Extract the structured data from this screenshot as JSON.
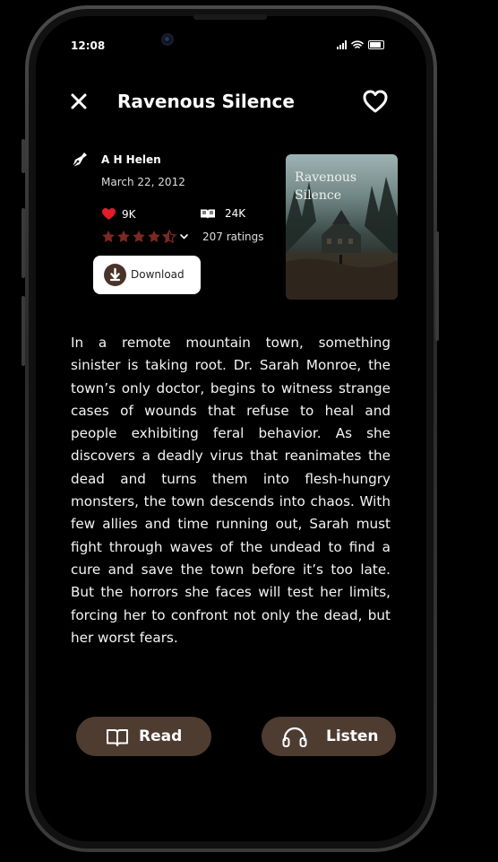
{
  "status": {
    "time": "12:08"
  },
  "header": {
    "title": "Ravenous Silence"
  },
  "book": {
    "author": "A H  Helen",
    "date": "March 22, 2012",
    "likes": "9K",
    "reads": "24K",
    "rating_stars": 4.5,
    "ratings_count": "207 ratings",
    "download_label": "Download",
    "cover_title_line1": "Ravenous",
    "cover_title_line2": "Silence"
  },
  "description": "In a remote mountain town, something sinister is taking root. Dr. Sarah Monroe, the town’s only doctor, begins to witness strange cases of wounds that refuse to heal and people exhibiting feral behavior. As she discovers a deadly virus that reanimates the dead and turns them into flesh-hungry monsters, the town descends into chaos. With few allies and time running out, Sarah must fight through waves of the undead to find a cure and save the town before it’s too late. But the horrors she faces will test her limits, forcing her to confront not only the dead, but her worst fears.",
  "actions": {
    "read_label": "Read",
    "listen_label": "Listen"
  },
  "colors": {
    "accent_brown": "#4e3c31",
    "star_color": "#7a2a22",
    "heart_red": "#e11d2a"
  },
  "icons": [
    "close-icon",
    "heart-outline-icon",
    "pen-icon",
    "heart-icon",
    "open-book-icon",
    "star-icon",
    "chevron-down-icon",
    "download-icon",
    "book-icon",
    "headphones-icon"
  ]
}
